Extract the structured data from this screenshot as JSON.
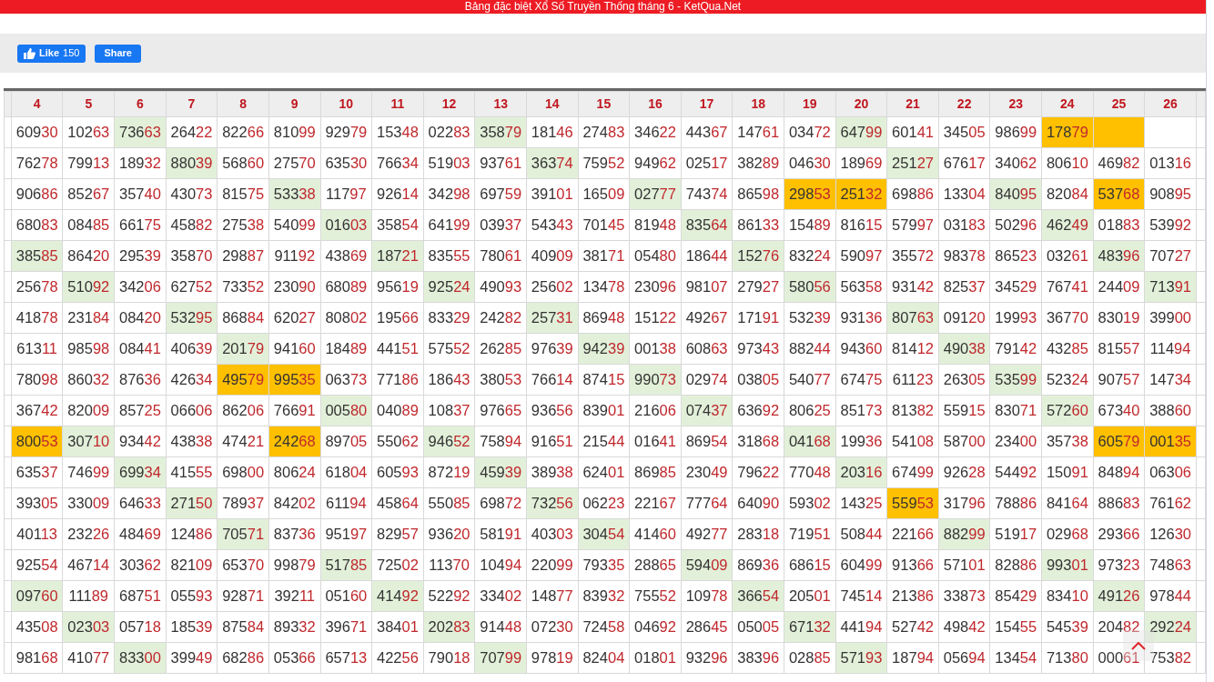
{
  "title": "Bảng đặc biệt Xổ Số Truyền Thống tháng 6 - KetQua.Net",
  "social": {
    "like_label": "Like",
    "like_count": "150",
    "share_label": "Share"
  },
  "columns": [
    "4",
    "5",
    "6",
    "7",
    "8",
    "9",
    "10",
    "11",
    "12",
    "13",
    "14",
    "15",
    "16",
    "17",
    "18",
    "19",
    "20",
    "21",
    "22",
    "23",
    "24",
    "25",
    "26"
  ],
  "rows": [
    [
      {
        "n": "60930"
      },
      {
        "n": "10263"
      },
      {
        "n": "73663",
        "color": "#e2f0d9"
      },
      {
        "n": "26422"
      },
      {
        "n": "82266"
      },
      {
        "n": "81099"
      },
      {
        "n": "92979"
      },
      {
        "n": "15348"
      },
      {
        "n": "02283"
      },
      {
        "n": "35879",
        "color": "#e2f0d9"
      },
      {
        "n": "18146"
      },
      {
        "n": "27483"
      },
      {
        "n": "34622"
      },
      {
        "n": "44367"
      },
      {
        "n": "14761"
      },
      {
        "n": "03472"
      },
      {
        "n": "64799",
        "color": "#e2f0d9"
      },
      {
        "n": "60141"
      },
      {
        "n": "34505"
      },
      {
        "n": "98699"
      },
      {
        "n": "17879",
        "color": "#ffc000"
      },
      {
        "color": "#ffc000"
      },
      {}
    ],
    [
      {
        "n": "76278"
      },
      {
        "n": "79913"
      },
      {
        "n": "18932"
      },
      {
        "n": "88039",
        "color": "#e2f0d9"
      },
      {
        "n": "56860"
      },
      {
        "n": "27570"
      },
      {
        "n": "63530"
      },
      {
        "n": "76634"
      },
      {
        "n": "51903"
      },
      {
        "n": "93761"
      },
      {
        "n": "36374",
        "color": "#e2f0d9"
      },
      {
        "n": "75952"
      },
      {
        "n": "94962"
      },
      {
        "n": "02517"
      },
      {
        "n": "38289"
      },
      {
        "n": "04630"
      },
      {
        "n": "18969"
      },
      {
        "n": "25127",
        "color": "#e2f0d9"
      },
      {
        "n": "67617"
      },
      {
        "n": "34062"
      },
      {
        "n": "80610"
      },
      {
        "n": "46982"
      },
      {
        "n": "01316"
      }
    ],
    [
      {
        "n": "90686"
      },
      {
        "n": "85267"
      },
      {
        "n": "35740"
      },
      {
        "n": "43073"
      },
      {
        "n": "81575"
      },
      {
        "n": "53338",
        "color": "#e2f0d9"
      },
      {
        "n": "11797"
      },
      {
        "n": "92614"
      },
      {
        "n": "34298"
      },
      {
        "n": "69759"
      },
      {
        "n": "39101"
      },
      {
        "n": "16509"
      },
      {
        "n": "02777",
        "color": "#e2f0d9"
      },
      {
        "n": "74374"
      },
      {
        "n": "86598"
      },
      {
        "n": "29853",
        "color": "#ffc000"
      },
      {
        "n": "25132",
        "color": "#ffc000"
      },
      {
        "n": "69886"
      },
      {
        "n": "13304"
      },
      {
        "n": "84095",
        "color": "#e2f0d9"
      },
      {
        "n": "82084"
      },
      {
        "n": "53768",
        "color": "#ffc000"
      },
      {
        "n": "90895"
      }
    ],
    [
      {
        "n": "68083"
      },
      {
        "n": "08485"
      },
      {
        "n": "66175"
      },
      {
        "n": "45882"
      },
      {
        "n": "27538"
      },
      {
        "n": "54099"
      },
      {
        "n": "01603",
        "color": "#e2f0d9"
      },
      {
        "n": "35854"
      },
      {
        "n": "64199"
      },
      {
        "n": "03937"
      },
      {
        "n": "54343"
      },
      {
        "n": "70145"
      },
      {
        "n": "81948"
      },
      {
        "n": "83564",
        "color": "#e2f0d9"
      },
      {
        "n": "86133"
      },
      {
        "n": "15489"
      },
      {
        "n": "81615"
      },
      {
        "n": "57997"
      },
      {
        "n": "03183"
      },
      {
        "n": "50296"
      },
      {
        "n": "46249",
        "color": "#e2f0d9"
      },
      {
        "n": "01883"
      },
      {
        "n": "53992"
      }
    ],
    [
      {
        "n": "38585",
        "color": "#e2f0d9"
      },
      {
        "n": "86420"
      },
      {
        "n": "29539"
      },
      {
        "n": "35870"
      },
      {
        "n": "29887"
      },
      {
        "n": "91192"
      },
      {
        "n": "43869"
      },
      {
        "n": "18721",
        "color": "#e2f0d9"
      },
      {
        "n": "83555"
      },
      {
        "n": "78061"
      },
      {
        "n": "40909"
      },
      {
        "n": "38171"
      },
      {
        "n": "05480"
      },
      {
        "n": "18644"
      },
      {
        "n": "15276",
        "color": "#e2f0d9"
      },
      {
        "n": "83224"
      },
      {
        "n": "59097"
      },
      {
        "n": "35572"
      },
      {
        "n": "98378"
      },
      {
        "n": "86523"
      },
      {
        "n": "03261"
      },
      {
        "n": "48396",
        "color": "#e2f0d9"
      },
      {
        "n": "70727"
      }
    ],
    [
      {
        "n": "25678"
      },
      {
        "n": "51092",
        "color": "#e2f0d9"
      },
      {
        "n": "34206"
      },
      {
        "n": "62752"
      },
      {
        "n": "73352"
      },
      {
        "n": "23090"
      },
      {
        "n": "68089"
      },
      {
        "n": "95619"
      },
      {
        "n": "92524",
        "color": "#e2f0d9"
      },
      {
        "n": "49093"
      },
      {
        "n": "25602"
      },
      {
        "n": "13478"
      },
      {
        "n": "23096"
      },
      {
        "n": "98107"
      },
      {
        "n": "27927"
      },
      {
        "n": "58056",
        "color": "#e2f0d9"
      },
      {
        "n": "56358"
      },
      {
        "n": "93142"
      },
      {
        "n": "82537"
      },
      {
        "n": "34529"
      },
      {
        "n": "76741"
      },
      {
        "n": "24409"
      },
      {
        "n": "71391",
        "color": "#e2f0d9"
      }
    ],
    [
      {
        "n": "41878"
      },
      {
        "n": "23184"
      },
      {
        "n": "08420"
      },
      {
        "n": "53295",
        "color": "#e2f0d9"
      },
      {
        "n": "86884"
      },
      {
        "n": "62027"
      },
      {
        "n": "80802"
      },
      {
        "n": "19566"
      },
      {
        "n": "83329"
      },
      {
        "n": "24282"
      },
      {
        "n": "25731",
        "color": "#e2f0d9"
      },
      {
        "n": "86948"
      },
      {
        "n": "15122"
      },
      {
        "n": "49267"
      },
      {
        "n": "17191"
      },
      {
        "n": "53239"
      },
      {
        "n": "93136"
      },
      {
        "n": "80763",
        "color": "#e2f0d9"
      },
      {
        "n": "09120"
      },
      {
        "n": "19993"
      },
      {
        "n": "36770"
      },
      {
        "n": "83019"
      },
      {
        "n": "39900"
      }
    ],
    [
      {
        "n": "61311"
      },
      {
        "n": "98598"
      },
      {
        "n": "08441"
      },
      {
        "n": "40639"
      },
      {
        "n": "20179",
        "color": "#e2f0d9"
      },
      {
        "n": "94160"
      },
      {
        "n": "18489"
      },
      {
        "n": "44151"
      },
      {
        "n": "57552"
      },
      {
        "n": "26285"
      },
      {
        "n": "97639"
      },
      {
        "n": "94239",
        "color": "#e2f0d9"
      },
      {
        "n": "00138"
      },
      {
        "n": "60863"
      },
      {
        "n": "97343"
      },
      {
        "n": "88244"
      },
      {
        "n": "94360"
      },
      {
        "n": "81412"
      },
      {
        "n": "49038",
        "color": "#e2f0d9"
      },
      {
        "n": "79142"
      },
      {
        "n": "43285"
      },
      {
        "n": "81557"
      },
      {
        "n": "11494"
      }
    ],
    [
      {
        "n": "78098"
      },
      {
        "n": "86032"
      },
      {
        "n": "87636"
      },
      {
        "n": "42634"
      },
      {
        "n": "49579",
        "color": "#ffc000"
      },
      {
        "n": "99535",
        "color": "#ffc000"
      },
      {
        "n": "06373"
      },
      {
        "n": "77186"
      },
      {
        "n": "18643"
      },
      {
        "n": "38053"
      },
      {
        "n": "76614"
      },
      {
        "n": "87415"
      },
      {
        "n": "99073",
        "color": "#e2f0d9"
      },
      {
        "n": "02974"
      },
      {
        "n": "03805"
      },
      {
        "n": "54077"
      },
      {
        "n": "67475"
      },
      {
        "n": "61123"
      },
      {
        "n": "26305"
      },
      {
        "n": "53599",
        "color": "#e2f0d9"
      },
      {
        "n": "52324"
      },
      {
        "n": "90757"
      },
      {
        "n": "14734"
      }
    ],
    [
      {
        "n": "36742"
      },
      {
        "n": "82009"
      },
      {
        "n": "85725"
      },
      {
        "n": "06606"
      },
      {
        "n": "86206"
      },
      {
        "n": "76691"
      },
      {
        "n": "00580",
        "color": "#e2f0d9"
      },
      {
        "n": "04089"
      },
      {
        "n": "10837"
      },
      {
        "n": "97665"
      },
      {
        "n": "93656"
      },
      {
        "n": "83901"
      },
      {
        "n": "21606"
      },
      {
        "n": "07437",
        "color": "#e2f0d9"
      },
      {
        "n": "63692"
      },
      {
        "n": "80625"
      },
      {
        "n": "85173"
      },
      {
        "n": "81382"
      },
      {
        "n": "55915"
      },
      {
        "n": "83071"
      },
      {
        "n": "57260",
        "color": "#e2f0d9"
      },
      {
        "n": "67340"
      },
      {
        "n": "38860"
      }
    ],
    [
      {
        "n": "80053",
        "color": "#ffc000"
      },
      {
        "n": "30710",
        "color": "#e2f0d9"
      },
      {
        "n": "93442"
      },
      {
        "n": "43838"
      },
      {
        "n": "47421"
      },
      {
        "n": "24268",
        "color": "#ffc000"
      },
      {
        "n": "89705"
      },
      {
        "n": "55062"
      },
      {
        "n": "94652",
        "color": "#e2f0d9"
      },
      {
        "n": "75894"
      },
      {
        "n": "91651"
      },
      {
        "n": "21544"
      },
      {
        "n": "01641"
      },
      {
        "n": "86954"
      },
      {
        "n": "31868"
      },
      {
        "n": "04168",
        "color": "#e2f0d9"
      },
      {
        "n": "19936"
      },
      {
        "n": "54108"
      },
      {
        "n": "58700"
      },
      {
        "n": "23400"
      },
      {
        "n": "35738"
      },
      {
        "n": "60579",
        "color": "#ffc000"
      },
      {
        "n": "00135",
        "color": "#ffc000"
      }
    ],
    [
      {
        "n": "63537"
      },
      {
        "n": "74699"
      },
      {
        "n": "69934",
        "color": "#e2f0d9"
      },
      {
        "n": "41555"
      },
      {
        "n": "69800"
      },
      {
        "n": "80624"
      },
      {
        "n": "61804"
      },
      {
        "n": "60593"
      },
      {
        "n": "87219"
      },
      {
        "n": "45939",
        "color": "#e2f0d9"
      },
      {
        "n": "38938"
      },
      {
        "n": "62401"
      },
      {
        "n": "86985"
      },
      {
        "n": "23049"
      },
      {
        "n": "79622"
      },
      {
        "n": "77048"
      },
      {
        "n": "20316",
        "color": "#e2f0d9"
      },
      {
        "n": "67499"
      },
      {
        "n": "92628"
      },
      {
        "n": "54492"
      },
      {
        "n": "15091"
      },
      {
        "n": "84894"
      },
      {
        "n": "06306"
      }
    ],
    [
      {
        "n": "39305"
      },
      {
        "n": "33009"
      },
      {
        "n": "64633"
      },
      {
        "n": "27150",
        "color": "#e2f0d9"
      },
      {
        "n": "78937"
      },
      {
        "n": "84202"
      },
      {
        "n": "61194"
      },
      {
        "n": "45864"
      },
      {
        "n": "55085"
      },
      {
        "n": "69872"
      },
      {
        "n": "73256",
        "color": "#e2f0d9"
      },
      {
        "n": "06223"
      },
      {
        "n": "22167"
      },
      {
        "n": "77764"
      },
      {
        "n": "64090"
      },
      {
        "n": "59302"
      },
      {
        "n": "14325"
      },
      {
        "n": "55953",
        "color": "#ffc000"
      },
      {
        "n": "31796"
      },
      {
        "n": "78886"
      },
      {
        "n": "84164"
      },
      {
        "n": "88683"
      },
      {
        "n": "76162"
      }
    ],
    [
      {
        "n": "40113"
      },
      {
        "n": "23226"
      },
      {
        "n": "48469"
      },
      {
        "n": "12486"
      },
      {
        "n": "70571",
        "color": "#e2f0d9"
      },
      {
        "n": "83736"
      },
      {
        "n": "95197"
      },
      {
        "n": "82957"
      },
      {
        "n": "93620"
      },
      {
        "n": "58191"
      },
      {
        "n": "40303"
      },
      {
        "n": "30454",
        "color": "#e2f0d9"
      },
      {
        "n": "41460"
      },
      {
        "n": "49277"
      },
      {
        "n": "28318"
      },
      {
        "n": "71951"
      },
      {
        "n": "50844"
      },
      {
        "n": "22166"
      },
      {
        "n": "88299",
        "color": "#e2f0d9"
      },
      {
        "n": "51917"
      },
      {
        "n": "02968"
      },
      {
        "n": "29366"
      },
      {
        "n": "12630"
      }
    ],
    [
      {
        "n": "92554"
      },
      {
        "n": "46714"
      },
      {
        "n": "30362"
      },
      {
        "n": "82109"
      },
      {
        "n": "65370"
      },
      {
        "n": "99879"
      },
      {
        "n": "51785",
        "color": "#e2f0d9"
      },
      {
        "n": "72502"
      },
      {
        "n": "11370"
      },
      {
        "n": "10494"
      },
      {
        "n": "22099"
      },
      {
        "n": "79335"
      },
      {
        "n": "28865"
      },
      {
        "n": "59409",
        "color": "#e2f0d9"
      },
      {
        "n": "86936"
      },
      {
        "n": "68615"
      },
      {
        "n": "60499"
      },
      {
        "n": "91366"
      },
      {
        "n": "57101"
      },
      {
        "n": "82886"
      },
      {
        "n": "99301",
        "color": "#e2f0d9"
      },
      {
        "n": "97323"
      },
      {
        "n": "74863"
      }
    ],
    [
      {
        "n": "09760",
        "color": "#e2f0d9"
      },
      {
        "n": "11189"
      },
      {
        "n": "68751"
      },
      {
        "n": "05593"
      },
      {
        "n": "92871"
      },
      {
        "n": "39211"
      },
      {
        "n": "05160"
      },
      {
        "n": "41492",
        "color": "#e2f0d9"
      },
      {
        "n": "52292"
      },
      {
        "n": "33402"
      },
      {
        "n": "14877"
      },
      {
        "n": "83932"
      },
      {
        "n": "75552"
      },
      {
        "n": "10978"
      },
      {
        "n": "36654",
        "color": "#e2f0d9"
      },
      {
        "n": "20501"
      },
      {
        "n": "74514"
      },
      {
        "n": "21386"
      },
      {
        "n": "33873"
      },
      {
        "n": "85429"
      },
      {
        "n": "83410"
      },
      {
        "n": "49126",
        "color": "#e2f0d9"
      },
      {
        "n": "97844"
      }
    ],
    [
      {
        "n": "43508"
      },
      {
        "n": "02303",
        "color": "#e2f0d9"
      },
      {
        "n": "05718"
      },
      {
        "n": "18539"
      },
      {
        "n": "87584"
      },
      {
        "n": "89332"
      },
      {
        "n": "39671"
      },
      {
        "n": "38401"
      },
      {
        "n": "20283",
        "color": "#e2f0d9"
      },
      {
        "n": "91448"
      },
      {
        "n": "07230"
      },
      {
        "n": "72458"
      },
      {
        "n": "04692"
      },
      {
        "n": "28645"
      },
      {
        "n": "05005"
      },
      {
        "n": "67132",
        "color": "#e2f0d9"
      },
      {
        "n": "44194"
      },
      {
        "n": "52742"
      },
      {
        "n": "49842"
      },
      {
        "n": "15455"
      },
      {
        "n": "54539"
      },
      {
        "n": "20482"
      },
      {
        "n": "29224",
        "color": "#e2f0d9"
      }
    ],
    [
      {
        "n": "98168"
      },
      {
        "n": "41077"
      },
      {
        "n": "83300",
        "color": "#e2f0d9"
      },
      {
        "n": "39949"
      },
      {
        "n": "68286"
      },
      {
        "n": "05366"
      },
      {
        "n": "65713"
      },
      {
        "n": "42256"
      },
      {
        "n": "79018"
      },
      {
        "n": "70799",
        "color": "#e2f0d9"
      },
      {
        "n": "97819"
      },
      {
        "n": "82404"
      },
      {
        "n": "01801"
      },
      {
        "n": "93296"
      },
      {
        "n": "38396"
      },
      {
        "n": "02885"
      },
      {
        "n": "57193",
        "color": "#e2f0d9"
      },
      {
        "n": "18794"
      },
      {
        "n": "05694"
      },
      {
        "n": "13454"
      },
      {
        "n": "71380"
      },
      {
        "n": "00061"
      },
      {
        "n": "75382"
      }
    ]
  ]
}
